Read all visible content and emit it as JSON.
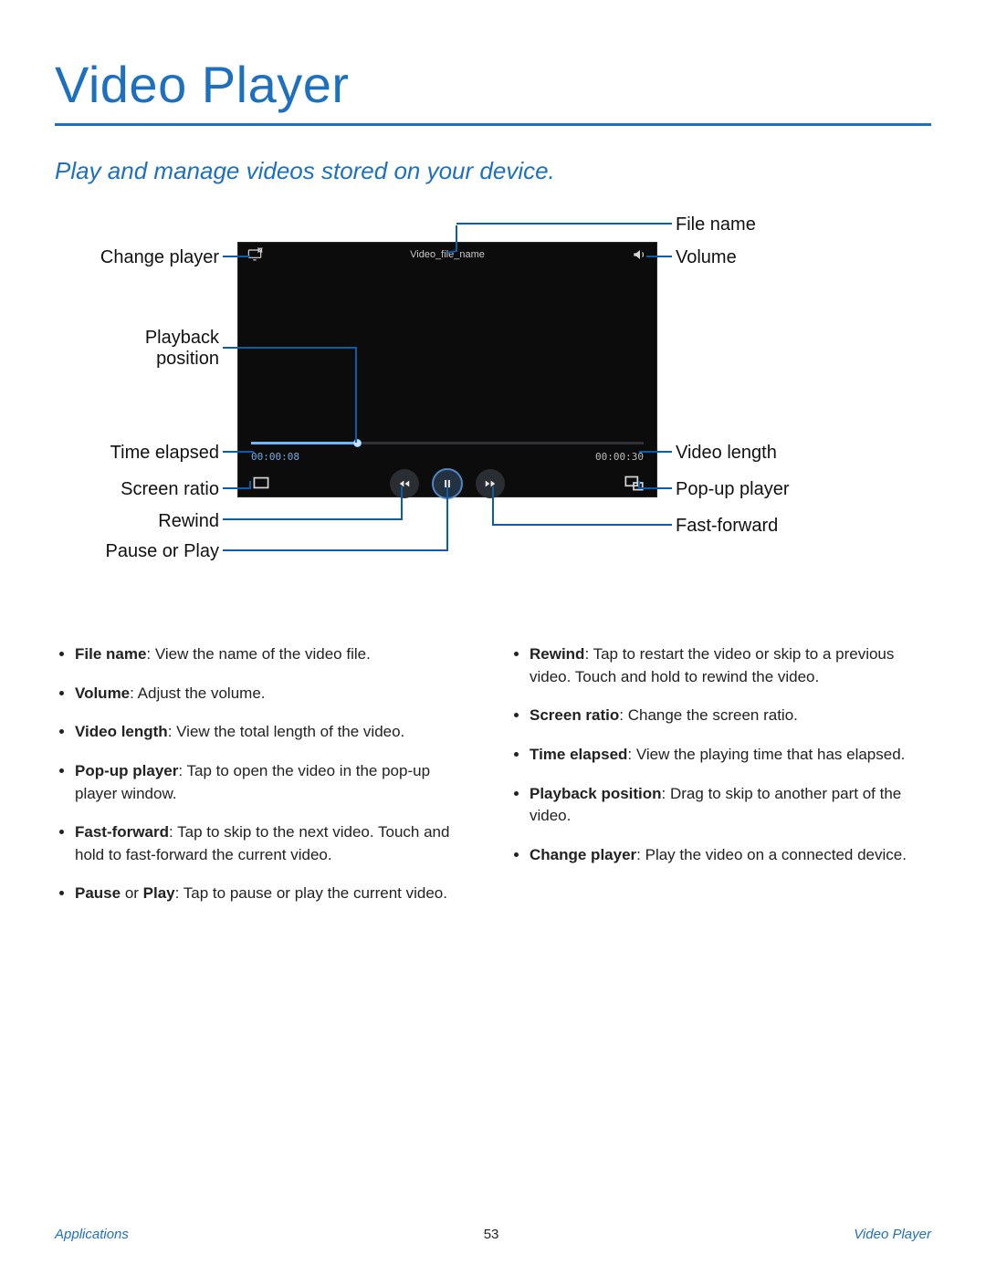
{
  "title": "Video Player",
  "subtitle": "Play and manage videos stored on your device.",
  "callouts": {
    "file_name": "File name",
    "volume": "Volume",
    "video_length": "Video length",
    "popup_player": "Pop-up player",
    "fast_forward": "Fast-forward",
    "change_player": "Change player",
    "playback_position": "Playback\nposition",
    "time_elapsed": "Time elapsed",
    "screen_ratio": "Screen ratio",
    "rewind": "Rewind",
    "pause_or_play": "Pause or Play"
  },
  "player": {
    "file_title": "Video_file_name",
    "time_elapsed": "00:00:08",
    "time_total": "00:00:30"
  },
  "bullets_left": [
    {
      "term": "File name",
      "desc": ": View the name of the video file."
    },
    {
      "term": "Volume",
      "desc": ": Adjust the volume."
    },
    {
      "term": "Video length",
      "desc": ": View the total length of the video."
    },
    {
      "term": "Pop-up player",
      "desc": ": Tap to open the video in the pop-up player window."
    },
    {
      "term": "Fast-forward",
      "desc": ": Tap to skip to the next video. Touch and hold to fast-forward the current video."
    },
    {
      "term": "Pause",
      "desc": " or ",
      "term2": "Play",
      "desc2": ": Tap to pause or play the current video."
    }
  ],
  "bullets_right": [
    {
      "term": "Rewind",
      "desc": ": Tap to restart the video or skip to a previous video. Touch and hold to rewind the video."
    },
    {
      "term": "Screen ratio",
      "desc": ": Change the screen ratio."
    },
    {
      "term": "Time elapsed",
      "desc": ": View the playing time that has elapsed."
    },
    {
      "term": "Playback position",
      "desc": ": Drag to skip to another part of the video."
    },
    {
      "term": "Change player",
      "desc": ": Play the video on a connected device."
    }
  ],
  "footer": {
    "left": "Applications",
    "page": "53",
    "right": "Video Player"
  }
}
